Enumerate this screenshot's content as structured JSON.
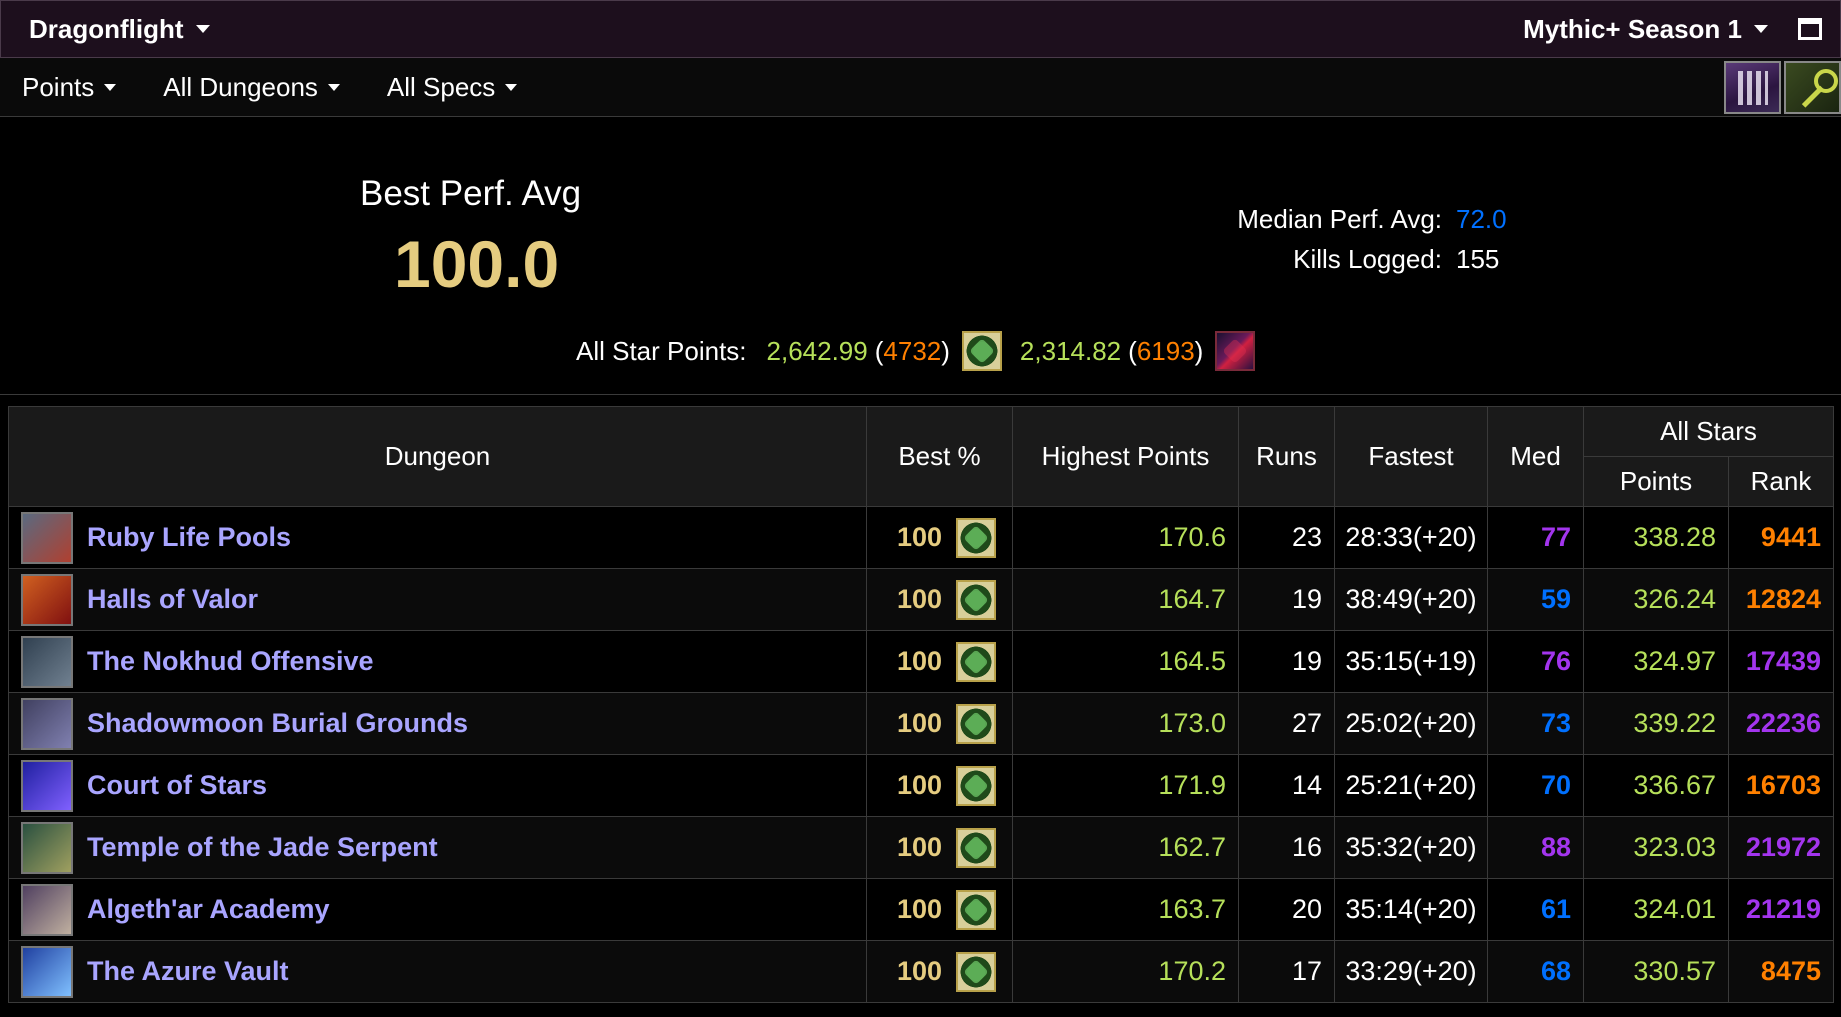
{
  "titlebar": {
    "expansion": "Dragonflight",
    "season": "Mythic+ Season 1"
  },
  "filters": [
    {
      "label": "Points"
    },
    {
      "label": "All Dungeons"
    },
    {
      "label": "All Specs"
    }
  ],
  "summary": {
    "best_perf_label": "Best Perf. Avg",
    "best_perf_value": "100.0",
    "median_label": "Median Perf. Avg:",
    "median_value": "72.0",
    "kills_label": "Kills Logged:",
    "kills_value": "155",
    "allstar_label": "All Star Points:",
    "allstars": [
      {
        "points": "2,642.99",
        "rank": "4732",
        "spec_icon": "restoration-druid-icon"
      },
      {
        "points": "2,314.82",
        "rank": "6193",
        "spec_icon": "havoc-demon-hunter-icon"
      }
    ]
  },
  "colors": {
    "accent_gold": "#e5cc80",
    "points_green": "#b6e05a",
    "link_purple": "#a9a5ff",
    "rare_blue": "#0070ff",
    "epic_purple": "#a335ee",
    "legendary_orange": "#ff8000"
  },
  "table": {
    "headers": {
      "dungeon": "Dungeon",
      "best": "Best %",
      "highest": "Highest Points",
      "runs": "Runs",
      "fastest": "Fastest",
      "med": "Med",
      "allstars": "All Stars",
      "points": "Points",
      "rank": "Rank"
    },
    "rows": [
      {
        "dungeon": "Ruby Life Pools",
        "best": "100",
        "highest": "170.6",
        "runs": "23",
        "fastest": "28:33(+20)",
        "med": "77",
        "med_color": "#a335ee",
        "points": "338.28",
        "rank": "9441",
        "rank_color": "#ff8000",
        "icon_colors": [
          "#5a6a80",
          "#b04030"
        ]
      },
      {
        "dungeon": "Halls of Valor",
        "best": "100",
        "highest": "164.7",
        "runs": "19",
        "fastest": "38:49(+20)",
        "med": "59",
        "med_color": "#0070ff",
        "points": "326.24",
        "rank": "12824",
        "rank_color": "#ff8000",
        "icon_colors": [
          "#d06020",
          "#801010"
        ]
      },
      {
        "dungeon": "The Nokhud Offensive",
        "best": "100",
        "highest": "164.5",
        "runs": "19",
        "fastest": "35:15(+19)",
        "med": "76",
        "med_color": "#a335ee",
        "points": "324.97",
        "rank": "17439",
        "rank_color": "#a335ee",
        "icon_colors": [
          "#304050",
          "#708090"
        ]
      },
      {
        "dungeon": "Shadowmoon Burial Grounds",
        "best": "100",
        "highest": "173.0",
        "runs": "27",
        "fastest": "25:02(+20)",
        "med": "73",
        "med_color": "#0070ff",
        "points": "339.22",
        "rank": "22236",
        "rank_color": "#a335ee",
        "icon_colors": [
          "#404060",
          "#8080b0"
        ]
      },
      {
        "dungeon": "Court of Stars",
        "best": "100",
        "highest": "171.9",
        "runs": "14",
        "fastest": "25:21(+20)",
        "med": "70",
        "med_color": "#0070ff",
        "points": "336.67",
        "rank": "16703",
        "rank_color": "#ff8000",
        "icon_colors": [
          "#2020a0",
          "#8060ff"
        ]
      },
      {
        "dungeon": "Temple of the Jade Serpent",
        "best": "100",
        "highest": "162.7",
        "runs": "16",
        "fastest": "35:32(+20)",
        "med": "88",
        "med_color": "#a335ee",
        "points": "323.03",
        "rank": "21972",
        "rank_color": "#a335ee",
        "icon_colors": [
          "#2a5040",
          "#a0a060"
        ]
      },
      {
        "dungeon": "Algeth'ar Academy",
        "best": "100",
        "highest": "163.7",
        "runs": "20",
        "fastest": "35:14(+20)",
        "med": "61",
        "med_color": "#0070ff",
        "points": "324.01",
        "rank": "21219",
        "rank_color": "#a335ee",
        "icon_colors": [
          "#504060",
          "#c0b0a0"
        ]
      },
      {
        "dungeon": "The Azure Vault",
        "best": "100",
        "highest": "170.2",
        "runs": "17",
        "fastest": "33:29(+20)",
        "med": "68",
        "med_color": "#0070ff",
        "points": "330.57",
        "rank": "8475",
        "rank_color": "#ff8000",
        "icon_colors": [
          "#2040a0",
          "#80c0ff"
        ]
      }
    ]
  }
}
